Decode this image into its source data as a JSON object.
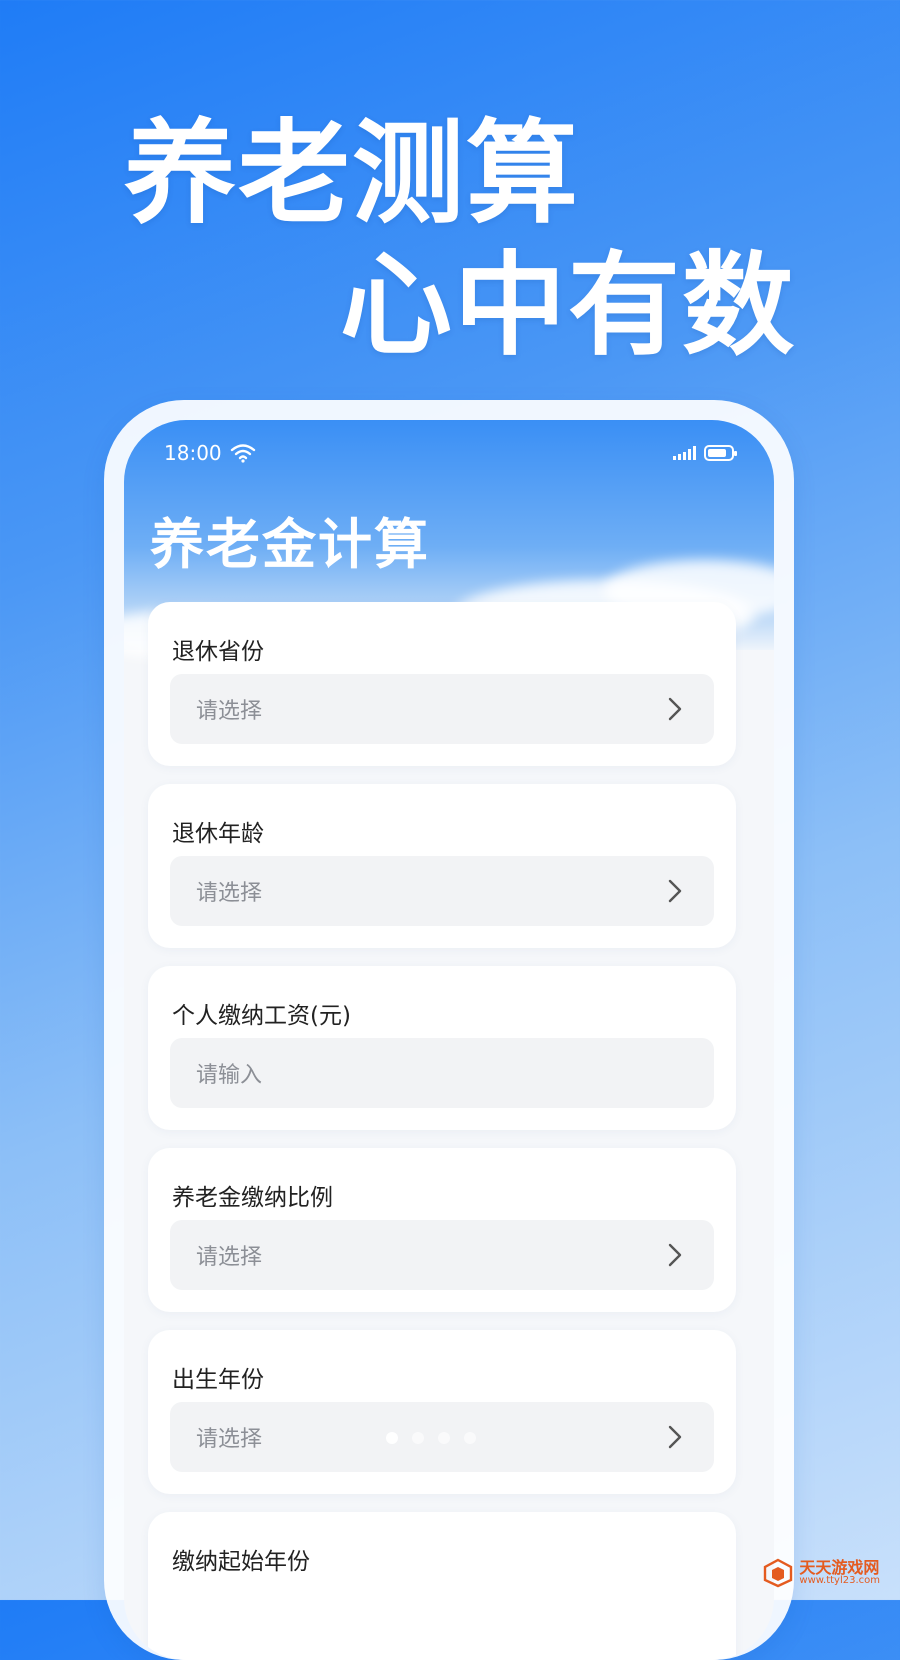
{
  "headline": {
    "line1": "养老测算",
    "line2": "心中有数"
  },
  "statusbar": {
    "time": "18:00"
  },
  "app": {
    "title": "养老金计算"
  },
  "form": {
    "fields": [
      {
        "label": "退休省份",
        "placeholder": "请选择",
        "type": "select"
      },
      {
        "label": "退休年龄",
        "placeholder": "请选择",
        "type": "select"
      },
      {
        "label": "个人缴纳工资(元)",
        "placeholder": "请输入",
        "type": "input"
      },
      {
        "label": "养老金缴纳比例",
        "placeholder": "请选择",
        "type": "select"
      },
      {
        "label": "出生年份",
        "placeholder": "请选择",
        "type": "select"
      },
      {
        "label": "缴纳起始年份",
        "placeholder": "",
        "type": "select"
      }
    ]
  },
  "carousel": {
    "active_index": 0,
    "count": 4
  },
  "watermark": {
    "name": "天天游戏网",
    "url": "www.ttyl23.com"
  },
  "colors": {
    "brand_blue": "#1f7cf6",
    "field_bg": "#f2f3f5",
    "watermark_orange": "#e45b1f"
  },
  "icons": {
    "wifi": "wifi-icon",
    "signal": "signal-icon",
    "battery": "battery-icon",
    "chevron": "chevron-right-icon"
  }
}
